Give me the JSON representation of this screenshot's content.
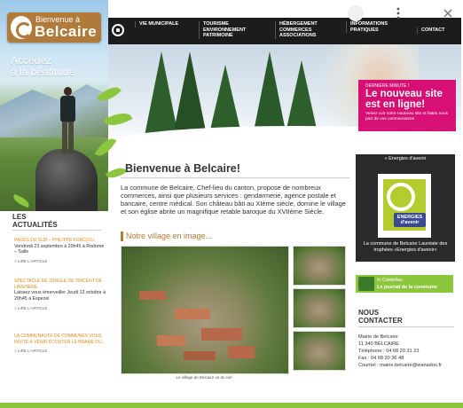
{
  "logo": {
    "small": "Bienvenue à",
    "big": "Belcaire"
  },
  "tagline": [
    "Accédez",
    "à la béatitude"
  ],
  "nav": [
    "Vie municipale",
    "Tourisme environnement patrimoine",
    "Hébergement commerces associations",
    "Informations pratiques",
    "Contact"
  ],
  "banner": {
    "kicker": "DERNIÈRE MINUTE !",
    "title": "Le nouveau site est en ligne!",
    "text": "Venez voir notre nouveau site et faites nous part de vos commentaires"
  },
  "sidebar": {
    "title": "Les actualités",
    "items": [
      {
        "title": "PAGES DU SUD – PHILIPPE FORCIOLI",
        "text": "Vendredi 23 septembre à 20h45 à Rodome – Salle",
        "more": "> LIRE L'ARTICLE"
      },
      {
        "title": "SPECTACLE DE JONGLE DE VINCENT DE LAVENÈRE",
        "text": "Laissez vous émerveiller Jeudi 13 octobre à 20h45 à Espezel",
        "more": "> LIRE L'ARTICLE"
      },
      {
        "title": "LA COMMUNAUTÉ DE COMMUNES VOUS INVITE À VENIR ÉCOUTER LE BRAME DU...",
        "text": "",
        "more": "> LIRE L'ARTICLE"
      }
    ]
  },
  "main": {
    "title": "Bienvenue à Belcaire!",
    "text": "La commune de Belcaire, Chef-lieu du canton, propose de nombreux commerces, ainsi que plusieurs services : gendarmerie, agence postale et bancaire, centre médical. Son château bâti au XIème siècle, domine le village et son église abrite un magnifique retable baroque du XVIIème Siècle.",
    "village_heading": "Notre village  en image...",
    "photo_caption": "Le village de Belcaire vu du ciel"
  },
  "right": {
    "energy_head": "« Energies d'avenir",
    "energy_badge": "ENERGIES d'avenir",
    "energy_caption": "La commune de Belcaire Lauréate des trophées «Energies d'avenir»",
    "gazette_line1": "In Castellas",
    "gazette_line2": "Le journal de la commune",
    "contact_title": "Nous contacter",
    "contact_lines": [
      "Mairie de Belcaire",
      "11 340 BELCAIRE",
      "Téléphone : 04 68 20 31 23",
      "Fax : 04 68 20 36 48",
      "Courriel : mairie.belcaire@wanadoo.fr"
    ]
  },
  "colors": {
    "accent_green": "#8cc63f",
    "brown": "#b07a3a",
    "pink": "#d6006c",
    "nav_bg": "#1c1c1c"
  }
}
